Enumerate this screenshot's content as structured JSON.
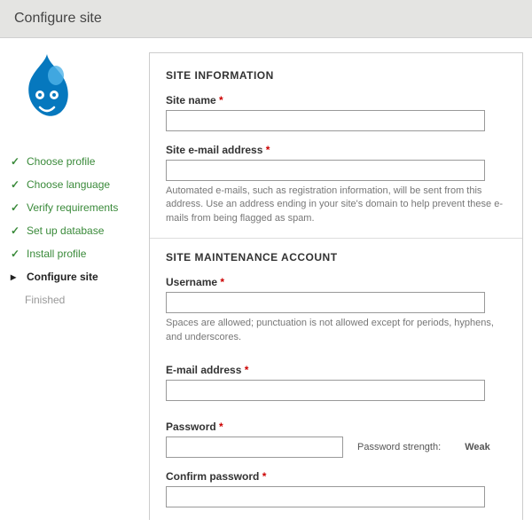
{
  "header": {
    "title": "Configure site"
  },
  "sidebar": {
    "steps": [
      {
        "label": "Choose profile",
        "state": "done"
      },
      {
        "label": "Choose language",
        "state": "done"
      },
      {
        "label": "Verify requirements",
        "state": "done"
      },
      {
        "label": "Set up database",
        "state": "done"
      },
      {
        "label": "Install profile",
        "state": "done"
      },
      {
        "label": "Configure site",
        "state": "current"
      },
      {
        "label": "Finished",
        "state": "pending"
      }
    ]
  },
  "form": {
    "required_marker": "*",
    "site_info": {
      "heading": "SITE INFORMATION",
      "site_name": {
        "label": "Site name",
        "value": ""
      },
      "site_email": {
        "label": "Site e-mail address",
        "value": "",
        "help": "Automated e-mails, such as registration information, will be sent from this address. Use an address ending in your site's domain to help prevent these e-mails from being flagged as spam."
      }
    },
    "maint": {
      "heading": "SITE MAINTENANCE ACCOUNT",
      "username": {
        "label": "Username",
        "value": "",
        "help": "Spaces are allowed; punctuation is not allowed except for periods, hyphens, and underscores."
      },
      "email": {
        "label": "E-mail address",
        "value": ""
      },
      "password": {
        "label": "Password",
        "value": "",
        "strength_label": "Password strength:",
        "strength_value": "Weak"
      },
      "confirm": {
        "label": "Confirm password",
        "value": ""
      }
    }
  },
  "icons": {
    "check": "✓",
    "arrow": "▸"
  }
}
